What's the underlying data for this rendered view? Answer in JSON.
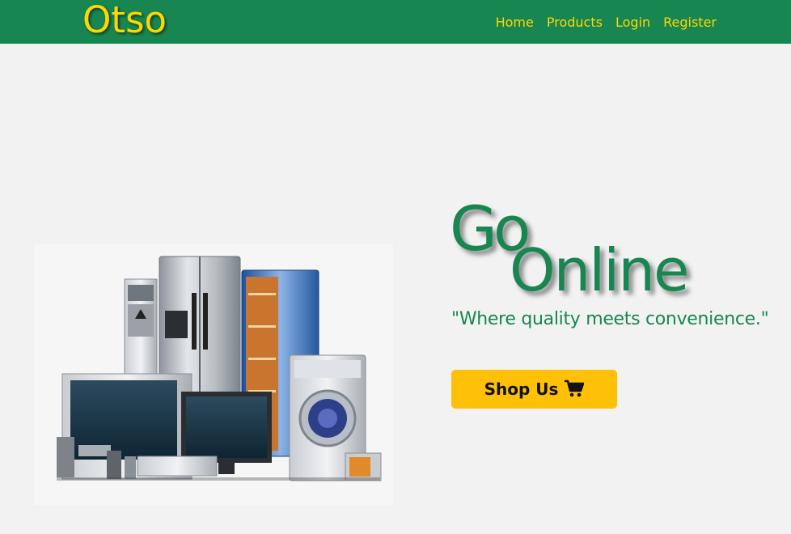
{
  "navbar": {
    "brand": "Otso",
    "links": [
      {
        "label": "Home"
      },
      {
        "label": "Products"
      },
      {
        "label": "Login"
      },
      {
        "label": "Register"
      }
    ],
    "colors": {
      "background": "#188650",
      "text": "#ffd700"
    }
  },
  "hero": {
    "image_icon": "home-appliances-image",
    "title_line1": "Go",
    "title_line2": "Online",
    "tagline": "\"Where quality meets convenience.\"",
    "button": {
      "label": "Shop Us",
      "icon": "shopping-cart-icon"
    },
    "colors": {
      "title": "#188650",
      "button": "#ffc107"
    }
  }
}
